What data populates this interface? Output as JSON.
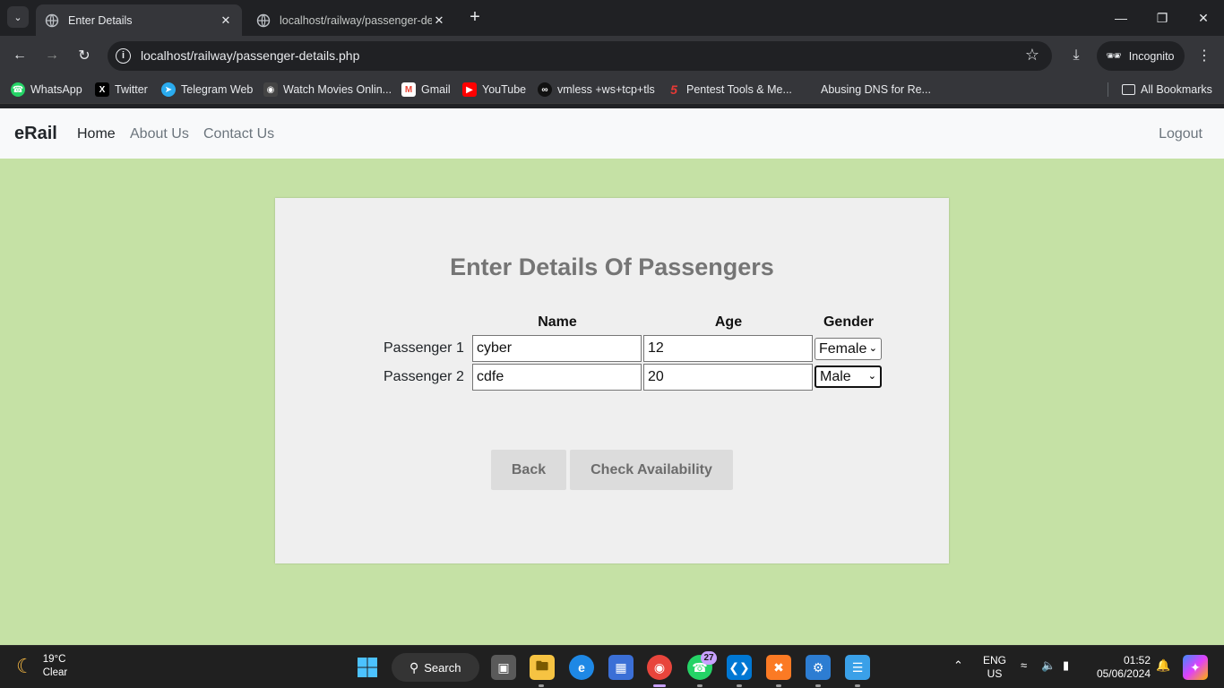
{
  "browser": {
    "tabs": [
      {
        "title": "Enter Details",
        "active": true
      },
      {
        "title": "localhost/railway/passenger-de",
        "active": false
      }
    ],
    "url": "localhost/railway/passenger-details.php",
    "profile_label": "Incognito",
    "bookmarks": [
      {
        "label": "WhatsApp",
        "icon": "whatsapp-icon",
        "color": "#25d366"
      },
      {
        "label": "Twitter",
        "icon": "x-icon",
        "color": "#000000"
      },
      {
        "label": "Telegram Web",
        "icon": "telegram-icon",
        "color": "#2aabee"
      },
      {
        "label": "Watch Movies Onlin...",
        "icon": "movie-icon",
        "color": "#444444"
      },
      {
        "label": "Gmail",
        "icon": "gmail-icon",
        "color": "#ea4335"
      },
      {
        "label": "YouTube",
        "icon": "youtube-icon",
        "color": "#ff0000"
      },
      {
        "label": "vmless +ws+tcp+tls",
        "icon": "vmless-icon",
        "color": "#111111"
      },
      {
        "label": "Pentest Tools & Me...",
        "icon": "pentest-icon",
        "color": "#e53935"
      },
      {
        "label": "Abusing DNS for Re...",
        "icon": "",
        "color": ""
      }
    ],
    "all_bookmarks_label": "All Bookmarks"
  },
  "site": {
    "brand": "eRail",
    "nav": [
      "Home",
      "About Us",
      "Contact Us"
    ],
    "logout": "Logout"
  },
  "form": {
    "heading": "Enter Details Of Passengers",
    "columns": {
      "name": "Name",
      "age": "Age",
      "gender": "Gender"
    },
    "passengers": [
      {
        "label": "Passenger 1",
        "name": "cyber",
        "age": "12",
        "gender": "Female"
      },
      {
        "label": "Passenger 2",
        "name": "cdfe",
        "age": "20",
        "gender": "Male"
      }
    ],
    "back_label": "Back",
    "check_label": "Check Availability"
  },
  "taskbar": {
    "temperature": "19°C",
    "condition": "Clear",
    "search_label": "Search",
    "whatsapp_badge": "27",
    "lang_top": "ENG",
    "lang_bottom": "US",
    "time": "01:52",
    "date": "05/06/2024"
  },
  "colors": {
    "page_bg": "#c5e1a5",
    "card_bg": "#efefef",
    "heading": "#757575",
    "button_bg": "#dcdcdc"
  }
}
